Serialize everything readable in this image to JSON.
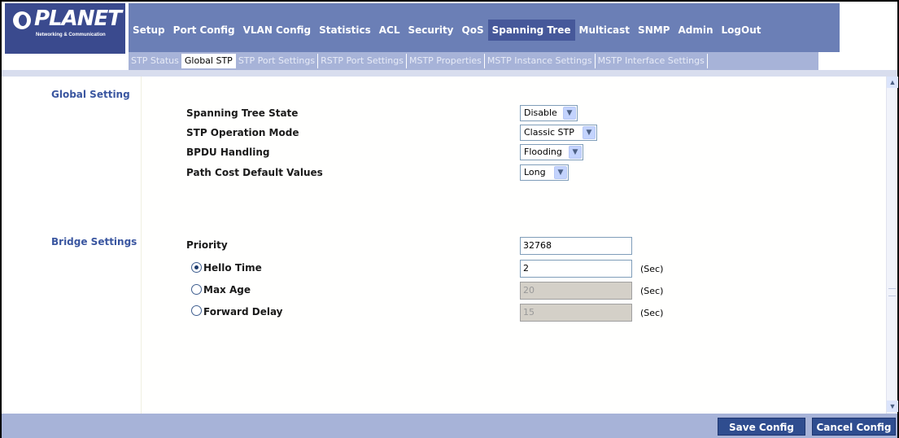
{
  "brand": {
    "logo_text": "PLANET",
    "logo_subtext": "Networking & Communication"
  },
  "main_nav": [
    {
      "label": "Setup",
      "active": false
    },
    {
      "label": "Port Config",
      "active": false
    },
    {
      "label": "VLAN Config",
      "active": false
    },
    {
      "label": "Statistics",
      "active": false
    },
    {
      "label": "ACL",
      "active": false
    },
    {
      "label": "Security",
      "active": false
    },
    {
      "label": "QoS",
      "active": false
    },
    {
      "label": "Spanning Tree",
      "active": true
    },
    {
      "label": "Multicast",
      "active": false
    },
    {
      "label": "SNMP",
      "active": false
    },
    {
      "label": "Admin",
      "active": false
    },
    {
      "label": "LogOut",
      "active": false
    }
  ],
  "sub_nav": [
    {
      "label": "STP Status",
      "active": false
    },
    {
      "label": "Global STP",
      "active": true
    },
    {
      "label": "STP Port Settings",
      "active": false
    },
    {
      "label": "RSTP Port Settings",
      "active": false
    },
    {
      "label": "MSTP Properties",
      "active": false
    },
    {
      "label": "MSTP Instance Settings",
      "active": false
    },
    {
      "label": "MSTP Interface Settings",
      "active": false
    }
  ],
  "global_setting": {
    "section_label": "Global Setting",
    "spanning_tree_state": {
      "label": "Spanning Tree State",
      "value": "Disable"
    },
    "stp_operation_mode": {
      "label": "STP Operation Mode",
      "value": "Classic STP"
    },
    "bpdu_handling": {
      "label": "BPDU Handling",
      "value": "Flooding"
    },
    "path_cost_default": {
      "label": "Path Cost Default Values",
      "value": "Long"
    }
  },
  "bridge_settings": {
    "section_label": "Bridge Settings",
    "priority": {
      "label": "Priority",
      "value": "32768"
    },
    "hello_time": {
      "label": "Hello Time",
      "value": "2",
      "unit": "(Sec)",
      "selected": true
    },
    "max_age": {
      "label": "Max Age",
      "value": "20",
      "unit": "(Sec)",
      "selected": false
    },
    "forward_delay": {
      "label": "Forward Delay",
      "value": "15",
      "unit": "(Sec)",
      "selected": false
    }
  },
  "footer": {
    "save_label": "Save Config",
    "cancel_label": "Cancel Config"
  },
  "icons": {
    "dropdown": "chevron-down-icon",
    "scroll_up": "scroll-up-icon",
    "scroll_down": "scroll-down-icon"
  }
}
